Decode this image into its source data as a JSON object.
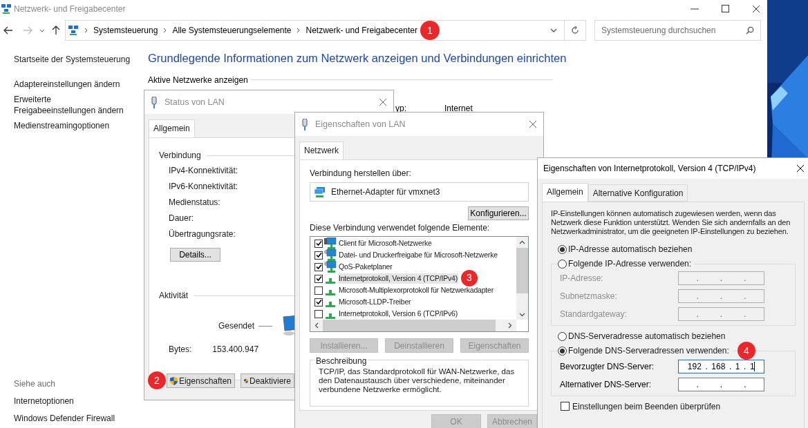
{
  "window": {
    "title": "Netzwerk- und Freigabecenter"
  },
  "address_bar": {
    "breadcrumb": [
      "Systemsteuerung",
      "Alle Systemsteuerungselemente",
      "Netzwerk- und Freigabecenter"
    ],
    "badge": "1"
  },
  "search": {
    "placeholder": "Systemsteuerung durchsuchen"
  },
  "sidebar": {
    "items": [
      "Startseite der Systemsteuerung",
      "Adaptereinstellungen ändern",
      "Erweiterte Freigabeeinstellungen ändern",
      "Medienstreamingoptionen"
    ],
    "see_also": {
      "title": "Siehe auch",
      "items": [
        "Internetoptionen",
        "Windows Defender Firewall"
      ]
    }
  },
  "main": {
    "heading": "Grundlegende Informationen zum Netzwerk anzeigen und Verbindungen einrichten",
    "section": "Aktive Netzwerke anzeigen",
    "access_label": "yp:",
    "access_value": "Internet"
  },
  "status_dialog": {
    "title": "Status von LAN",
    "tabs": [
      {
        "label": "Allgemein",
        "selected": true
      }
    ],
    "connection": {
      "title": "Verbindung",
      "fields": [
        "IPv4-Konnektivität:",
        "IPv6-Konnektivität:",
        "Medienstatus:",
        "Dauer:",
        "Übertragungsrate:"
      ]
    },
    "details_button": "Details...",
    "activity": {
      "title": "Aktivität",
      "sent_label": "Gesendet",
      "bytes_label": "Bytes:",
      "bytes_sent": "153.400.947"
    },
    "buttons": [
      {
        "label": "Eigenschaften",
        "badge": "2"
      },
      {
        "label": "Deaktiviere"
      }
    ]
  },
  "lan_dialog": {
    "title": "Eigenschaften von LAN",
    "tabs": [
      {
        "label": "Netzwerk",
        "selected": true
      }
    ],
    "connect_label": "Verbindung herstellen über:",
    "adapter": "Ethernet-Adapter für vmxnet3",
    "configure_button": "Konfigurieren...",
    "items_label": "Diese Verbindung verwendet folgende Elemente:",
    "items": [
      {
        "label": "Client für Microsoft-Netzwerke",
        "checked": true,
        "selected": false,
        "kind": "client"
      },
      {
        "label": "Datei- und Druckerfreigabe für Microsoft-Netzwerke",
        "checked": true,
        "selected": false,
        "kind": "service"
      },
      {
        "label": "QoS-Paketplaner",
        "checked": true,
        "selected": false,
        "kind": "service"
      },
      {
        "label": "Internetprotokoll, Version 4 (TCP/IPv4)",
        "checked": true,
        "selected": true,
        "kind": "protocol",
        "badge": "3"
      },
      {
        "label": "Microsoft-Multiplexorprotokoll für Netzwerkadapter",
        "checked": false,
        "selected": false,
        "kind": "protocol"
      },
      {
        "label": "Microsoft-LLDP-Treiber",
        "checked": true,
        "selected": false,
        "kind": "protocol"
      },
      {
        "label": "Internetprotokoll, Version 6 (TCP/IPv6)",
        "checked": false,
        "selected": false,
        "kind": "protocol"
      }
    ],
    "buttons": [
      {
        "label": "Installieren...",
        "disabled": true
      },
      {
        "label": "Deinstallieren",
        "disabled": true
      },
      {
        "label": "Eigenschaften",
        "disabled": true
      }
    ],
    "description": {
      "title": "Beschreibung",
      "text": "TCP/IP, das Standardprotokoll für WAN-Netzwerke, das den Datenaustausch über verschiedene, miteinander verbundene Netzwerke ermöglicht."
    },
    "footer_buttons": [
      {
        "label": "OK",
        "disabled": true
      },
      {
        "label": "Abbrechen",
        "disabled": true
      }
    ]
  },
  "ipv4_dialog": {
    "title": "Eigenschaften von Internetprotokoll, Version 4 (TCP/IPv4)",
    "tabs": [
      {
        "label": "Allgemein",
        "selected": true
      },
      {
        "label": "Alternative Konfiguration",
        "selected": false
      }
    ],
    "intro": "IP-Einstellungen können automatisch zugewiesen werden, wenn das Netzwerk diese Funktion unterstützt. Wenden Sie sich andernfalls an den Netzwerkadministrator, um die geeigneten IP-Einstellungen zu beziehen.",
    "ip_options": [
      {
        "label": "IP-Adresse automatisch beziehen",
        "selected": true
      },
      {
        "label": "Folgende IP-Adresse verwenden:",
        "selected": false
      }
    ],
    "ip_fields": [
      {
        "label": "IP-Adresse:",
        "parts": [
          ".",
          ".",
          "."
        ],
        "disabled": true,
        "focused": false
      },
      {
        "label": "Subnetzmaske:",
        "parts": [
          ".",
          ".",
          "."
        ],
        "disabled": true,
        "focused": false
      },
      {
        "label": "Standardgateway:",
        "parts": [
          ".",
          ".",
          "."
        ],
        "disabled": true,
        "focused": false
      }
    ],
    "dns_options": [
      {
        "label": "DNS-Serveradresse automatisch beziehen",
        "selected": false
      },
      {
        "label": "Folgende DNS-Serveradressen verwenden:",
        "selected": true,
        "badge": "4"
      }
    ],
    "dns_fields": [
      {
        "label": "Bevorzugter DNS-Server:",
        "parts": [
          "192",
          ".",
          "168",
          ".",
          "1",
          ".",
          "1"
        ],
        "disabled": false,
        "focused": true
      },
      {
        "label": "Alternativer DNS-Server:",
        "parts": [
          ".",
          ".",
          "."
        ],
        "disabled": false,
        "focused": false
      }
    ],
    "verify_checkbox": {
      "label": "Einstellungen beim Beenden überprüfen",
      "checked": false
    }
  }
}
